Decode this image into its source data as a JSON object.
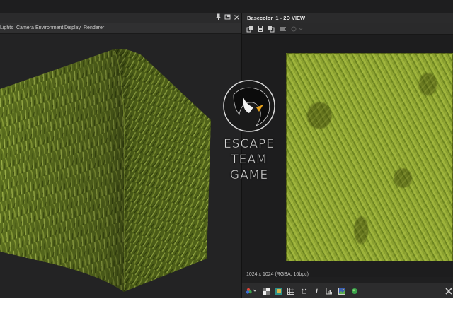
{
  "left_panel": {
    "menu": [
      "Lights",
      "Camera",
      "Environment",
      "Display",
      "Renderer"
    ],
    "title_controls": {
      "pin": "pin-icon",
      "float": "float-icon",
      "close": "close-icon"
    }
  },
  "right_panel": {
    "title": "Basecolor_1 - 2D VIEW",
    "resolution_text": "1024 x 1024 (RGBA, 16bpc)",
    "toolbar_icons": [
      "copy-icon",
      "save-icon",
      "duplicate-icon",
      "settings-icon",
      "zoom-icon"
    ],
    "bottom_icons": [
      "channels-icon",
      "checker-icon",
      "color-swatch-icon",
      "grid-icon",
      "reset-icon",
      "info-icon",
      "histogram-icon",
      "image-icon",
      "sphere-icon",
      "tiling-icon"
    ],
    "info_icon_glyph": "i"
  },
  "logo": {
    "lines": [
      "ESCAPE",
      "TEAM",
      "GAME"
    ]
  },
  "colors": {
    "grass_light": "#9db33a",
    "grass_dark": "#5d7219",
    "panel_bg": "#1e1e1f",
    "logo_accent": "#e8a21a"
  }
}
